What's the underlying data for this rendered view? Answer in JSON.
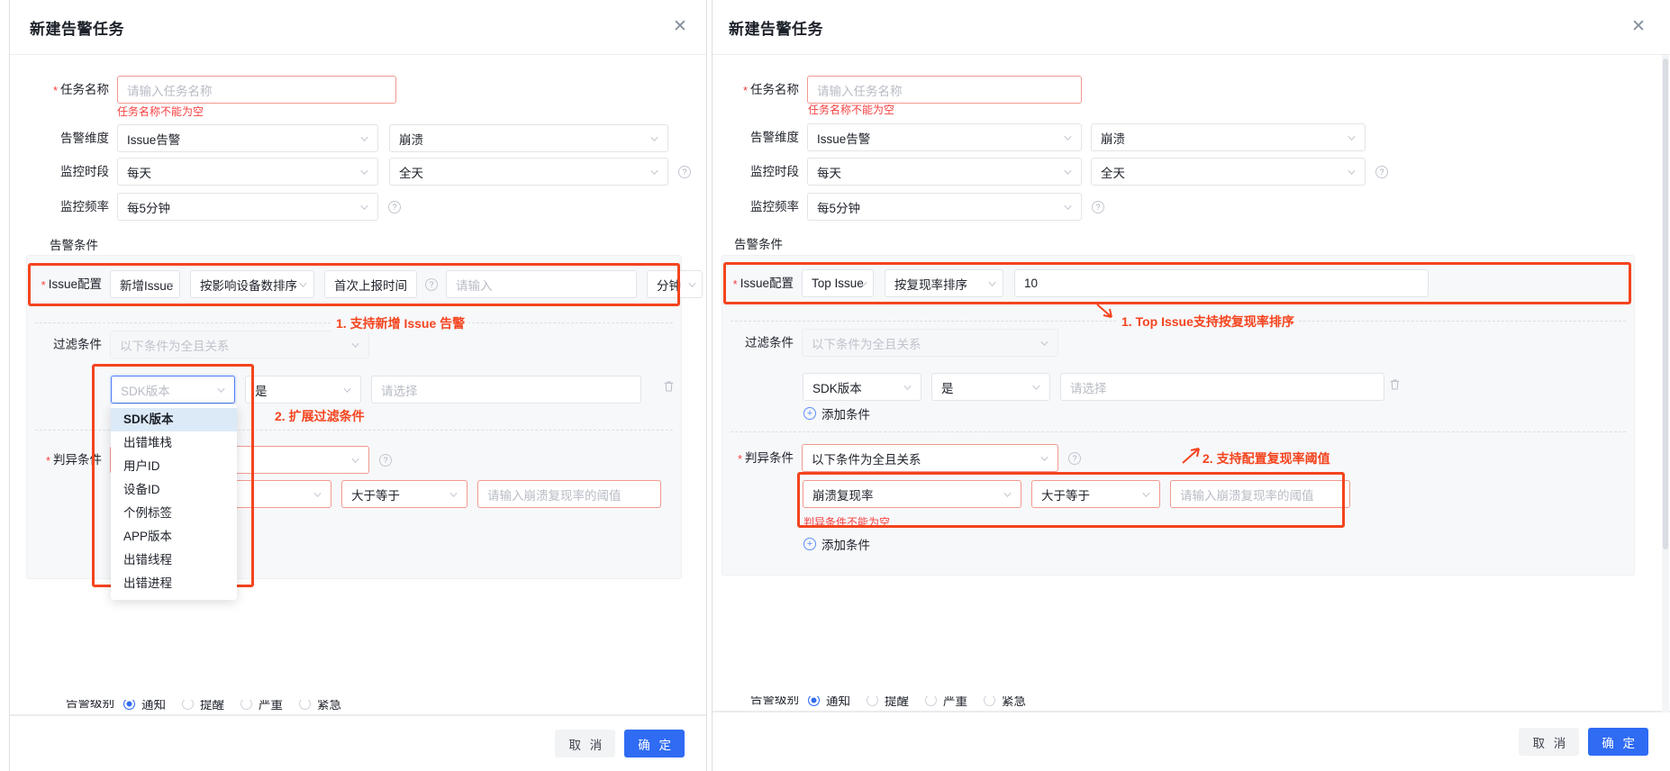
{
  "left": {
    "title": "新建告警任务",
    "close_icon": "close-icon",
    "task_name": {
      "label": "任务名称",
      "required": true,
      "placeholder": "请输入任务名称",
      "value": "",
      "error": "任务名称不能为空"
    },
    "alarm_dimension": {
      "label": "告警维度",
      "value1": "Issue告警",
      "value2": "崩溃"
    },
    "monitor_period": {
      "label": "监控时段",
      "value1": "每天",
      "value2": "全天",
      "help": "?"
    },
    "monitor_freq": {
      "label": "监控频率",
      "value": "每5分钟",
      "help": "?"
    },
    "alarm_condition_label": "告警条件",
    "issue_config": {
      "label": "Issue配置",
      "required": true,
      "mode": "新增Issue",
      "sort": "按影响设备数排序",
      "time_btn": "首次上报时间",
      "help": "?",
      "input_placeholder": "请输入",
      "input_value": "",
      "unit": "分钟"
    },
    "filter": {
      "label": "过滤条件",
      "relation": "以下条件为全且关系",
      "field": "SDK版本",
      "field_is_placeholder": true,
      "operator": "是",
      "value_placeholder": "请选择",
      "delete_icon": "trash-icon"
    },
    "dropdown": {
      "selected": "SDK版本",
      "items": [
        "SDK版本",
        "出错堆栈",
        "用户ID",
        "设备ID",
        "个例标签",
        "APP版本",
        "出错线程",
        "出错进程"
      ]
    },
    "judge": {
      "label": "判异条件",
      "required": true,
      "relation": "",
      "help": "?",
      "metric": "",
      "operator": "大于等于",
      "threshold_placeholder": "请输入崩溃复现率的阈值"
    },
    "alarm_level": {
      "label": "告警级别",
      "options": [
        "通知",
        "提醒",
        "严重",
        "紧急"
      ],
      "selected": "通知"
    },
    "annotations": [
      {
        "text": "1. 支持新增 Issue 告警"
      },
      {
        "text": "2. 扩展过滤条件"
      }
    ],
    "footer": {
      "cancel": "取 消",
      "confirm": "确 定"
    }
  },
  "right": {
    "title": "新建告警任务",
    "close_icon": "close-icon",
    "task_name": {
      "label": "任务名称",
      "required": true,
      "placeholder": "请输入任务名称",
      "value": "",
      "error": "任务名称不能为空"
    },
    "alarm_dimension": {
      "label": "告警维度",
      "value1": "Issue告警",
      "value2": "崩溃"
    },
    "monitor_period": {
      "label": "监控时段",
      "value1": "每天",
      "value2": "全天",
      "help": "?"
    },
    "monitor_freq": {
      "label": "监控频率",
      "value": "每5分钟",
      "help": "?"
    },
    "alarm_condition_label": "告警条件",
    "issue_config": {
      "label": "Issue配置",
      "required": true,
      "mode": "Top Issue",
      "sort": "按复现率排序",
      "count_value": "10"
    },
    "filter": {
      "label": "过滤条件",
      "relation": "以下条件为全且关系",
      "field": "SDK版本",
      "operator": "是",
      "value_placeholder": "请选择",
      "delete_icon": "trash-icon",
      "add": "添加条件"
    },
    "judge": {
      "label": "判异条件",
      "required": true,
      "relation": "以下条件为全且关系",
      "help": "?",
      "metric": "崩溃复现率",
      "operator": "大于等于",
      "threshold_placeholder": "请输入崩溃复现率的阈值",
      "error": "判异条件不能为空",
      "add": "添加条件"
    },
    "alarm_level": {
      "label": "告警级别",
      "options": [
        "通知",
        "提醒",
        "严重",
        "紧急"
      ],
      "selected": "通知"
    },
    "annotations": [
      {
        "text": "1. Top Issue支持按复现率排序"
      },
      {
        "text": "2. 支持配置复现率阈值"
      }
    ],
    "footer": {
      "cancel": "取 消",
      "confirm": "确 定"
    }
  },
  "colors": {
    "accent": "#2f6bf3",
    "danger": "#f53f3f",
    "annotation": "#f4441e",
    "panel_bg": "#f7f8fa"
  }
}
